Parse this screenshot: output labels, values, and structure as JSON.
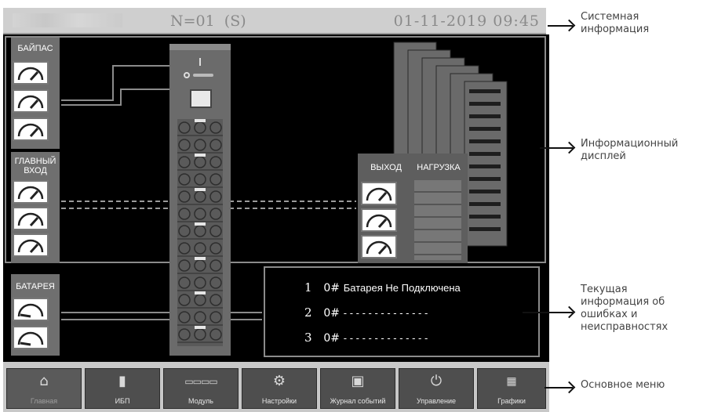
{
  "status_bar": {
    "unit": "N=01  (S)",
    "datetime": "01-11-2019 09:45"
  },
  "display": {
    "bypass_label": "БАЙПАС",
    "main_input_label": "ГЛАВНЫЙ ВХОД",
    "battery_label": "БАТАРЕЯ",
    "output_label": "ВЫХОД",
    "load_label": "НАГРУЗКА"
  },
  "faults": [
    {
      "num": "1",
      "code": "0#",
      "text": "Батарея Не Подключена"
    },
    {
      "num": "2",
      "code": "0#",
      "text": "- - - - - - - - - - - - - -"
    },
    {
      "num": "3",
      "code": "0#",
      "text": "- - - - - - - - - - - - - -"
    }
  ],
  "menu": [
    {
      "label": "Главная",
      "icon": "home-icon",
      "active": true
    },
    {
      "label": "ИБП",
      "icon": "ups-icon"
    },
    {
      "label": "Модуль",
      "icon": "module-icon"
    },
    {
      "label": "Настройки",
      "icon": "gear-icon"
    },
    {
      "label": "Журнал событий",
      "icon": "log-icon"
    },
    {
      "label": "Управление",
      "icon": "power-icon"
    },
    {
      "label": "Графики",
      "icon": "graph-icon"
    }
  ],
  "callouts": {
    "system_info": "Системная информация",
    "info_display": "Информационный дисплей",
    "fault_info": "Текущая информация об ошибках и неисправностях",
    "main_menu": "Основное меню"
  }
}
